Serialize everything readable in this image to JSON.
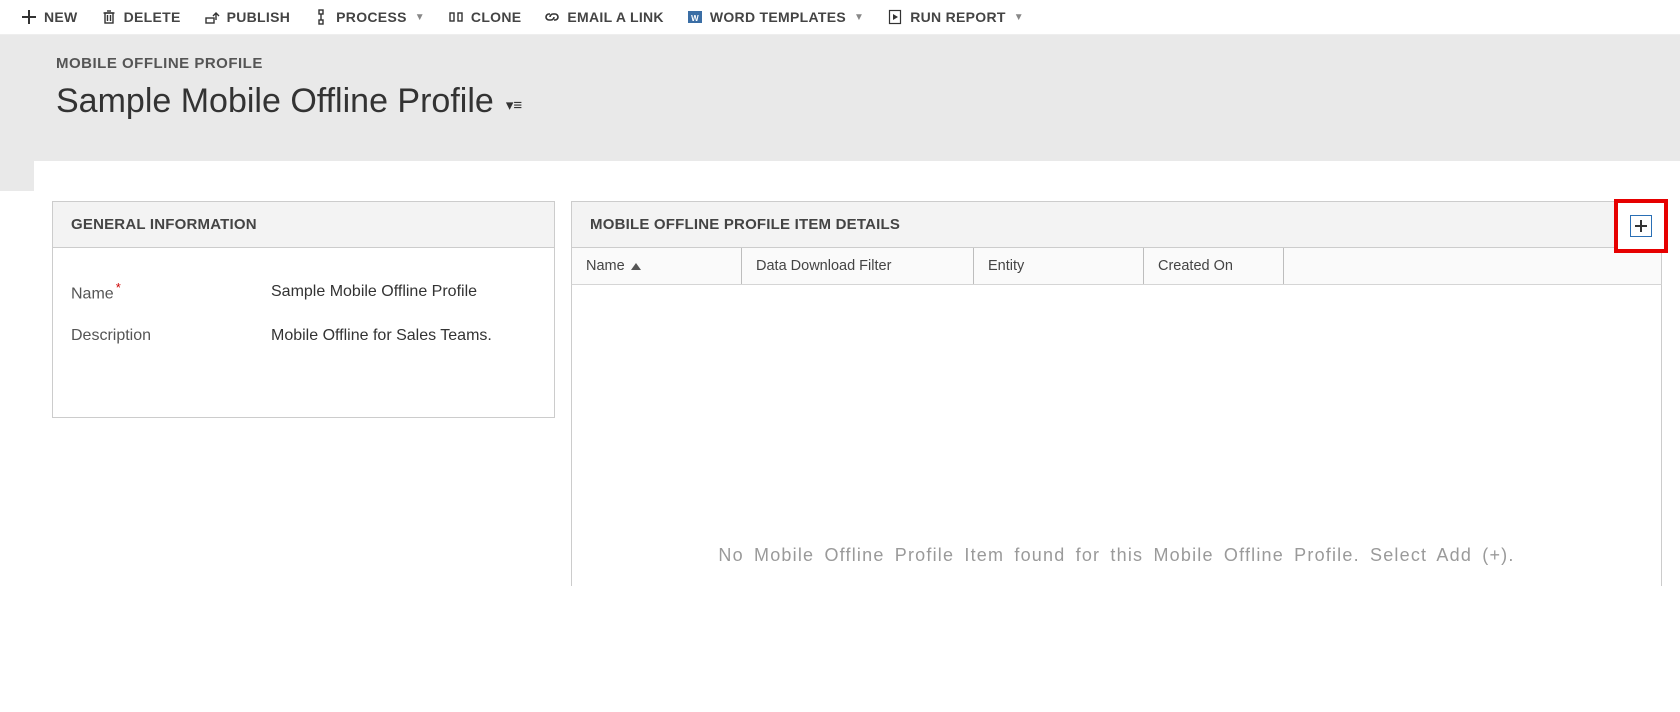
{
  "toolbar": {
    "new_label": "NEW",
    "delete_label": "DELETE",
    "publish_label": "PUBLISH",
    "process_label": "PROCESS",
    "clone_label": "CLONE",
    "email_label": "EMAIL A LINK",
    "word_label": "WORD TEMPLATES",
    "report_label": "RUN REPORT"
  },
  "header": {
    "crumb": "MOBILE OFFLINE PROFILE",
    "title": "Sample Mobile Offline Profile"
  },
  "general": {
    "panel_title": "GENERAL INFORMATION",
    "name_label": "Name",
    "name_value": "Sample Mobile Offline Profile",
    "desc_label": "Description",
    "desc_value": "Mobile Offline for Sales Teams."
  },
  "details": {
    "panel_title": "MOBILE OFFLINE PROFILE ITEM DETAILS",
    "columns": {
      "name": "Name",
      "filter": "Data Download Filter",
      "entity": "Entity",
      "created": "Created On"
    },
    "empty_message": "No Mobile Offline Profile Item found for this Mobile Offline Profile. Select Add (+)."
  }
}
